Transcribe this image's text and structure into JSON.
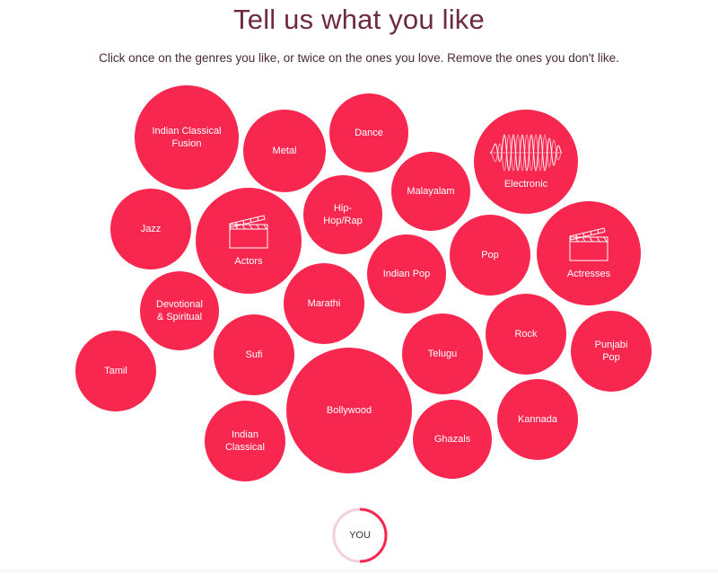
{
  "header": {
    "title": "Tell us what you like",
    "subtitle": "Click once on the genres you like, or twice on the ones you love. Remove the ones you don't like."
  },
  "colors": {
    "bubble": "#f8274f",
    "title": "#6e2a43",
    "ring_track": "#f4d0d8",
    "ring_progress": "#f8274f"
  },
  "genres": [
    {
      "label": "Indian Classical\nFusion"
    },
    {
      "label": "Metal"
    },
    {
      "label": "Dance"
    },
    {
      "label": "Electronic",
      "icon": "waveform-icon"
    },
    {
      "label": "Jazz"
    },
    {
      "label": "Actors",
      "icon": "clapperboard-icon"
    },
    {
      "label": "Hip-\nHop/Rap"
    },
    {
      "label": "Malayalam"
    },
    {
      "label": "Pop"
    },
    {
      "label": "Actresses",
      "icon": "clapperboard-icon"
    },
    {
      "label": "Indian Pop"
    },
    {
      "label": "Devotional\n& Spiritual"
    },
    {
      "label": "Marathi"
    },
    {
      "label": "Rock"
    },
    {
      "label": "Punjabi\nPop"
    },
    {
      "label": "Tamil"
    },
    {
      "label": "Sufi"
    },
    {
      "label": "Telugu"
    },
    {
      "label": "Bollywood"
    },
    {
      "label": "Kannada"
    },
    {
      "label": "Indian\nClassical"
    },
    {
      "label": "Ghazals"
    }
  ],
  "you_button": {
    "label": "YOU"
  }
}
